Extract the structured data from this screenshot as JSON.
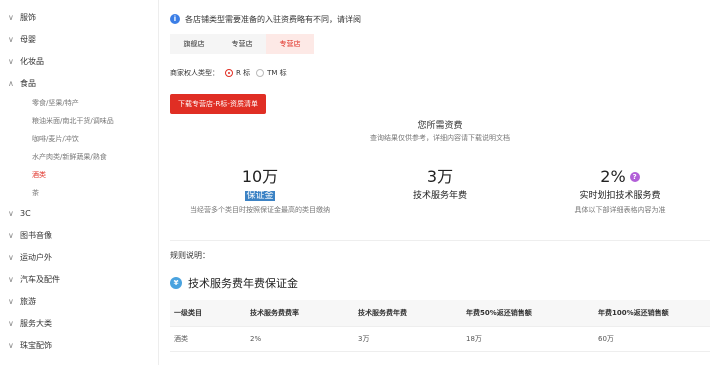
{
  "sidebar": {
    "categories": [
      {
        "label": "服饰",
        "expanded": false
      },
      {
        "label": "母婴",
        "expanded": false
      },
      {
        "label": "化妆品",
        "expanded": false
      },
      {
        "label": "食品",
        "expanded": true
      },
      {
        "label": "3C",
        "expanded": false
      },
      {
        "label": "图书音像",
        "expanded": false
      },
      {
        "label": "运动户外",
        "expanded": false
      },
      {
        "label": "汽车及配件",
        "expanded": false
      },
      {
        "label": "旅游",
        "expanded": false
      },
      {
        "label": "服务大类",
        "expanded": false
      },
      {
        "label": "珠宝配饰",
        "expanded": false
      }
    ],
    "food_subitems": [
      "零食/坚果/特产",
      "粮油米面/南北干货/调味品",
      "咖啡/麦片/冲饮",
      "水产肉类/新鲜蔬果/熟食",
      "酒类",
      "茶"
    ],
    "active_subitem": "酒类"
  },
  "notice": {
    "icon": "info-icon",
    "text": "各店铺类型需要准备的入驻资费略有不同，请详阅"
  },
  "tabs": [
    {
      "label": "旗舰店",
      "active": false
    },
    {
      "label": "专营店",
      "active": false
    },
    {
      "label": "专营店",
      "active": true
    }
  ],
  "trademark": {
    "label": "商家权人类型：",
    "options": [
      {
        "label": "R 标",
        "checked": true
      },
      {
        "label": "TM 标",
        "checked": false
      }
    ]
  },
  "download_button": "下载专营店-R标-资质清单",
  "fees": {
    "title": "您所需资费",
    "subtitle": "查询结果仅供参考，详细内容请下载说明文档",
    "items": [
      {
        "value": "10万",
        "label": "保证金",
        "desc": "当经营多个类目时按照保证金最高的类目缴纳"
      },
      {
        "value": "3万",
        "label": "技术服务年费",
        "desc": ""
      },
      {
        "value": "2%",
        "label": "实时划扣技术服务费",
        "desc": "具体以下部详细表格内容为准"
      }
    ]
  },
  "rules_label": "规则说明：",
  "section": {
    "title": "技术服务费年费保证金",
    "icon": "coin-icon"
  },
  "table": {
    "headers": [
      "一级类目",
      "技术服务费费率",
      "技术服务费年费",
      "年费50%返还销售额",
      "年费100%返还销售额"
    ],
    "rows": [
      [
        "酒类",
        "2%",
        "3万",
        "18万",
        "60万"
      ]
    ]
  },
  "colors": {
    "accent": "#e02e24",
    "info": "#3b7ee6",
    "help": "#b25fd8"
  }
}
